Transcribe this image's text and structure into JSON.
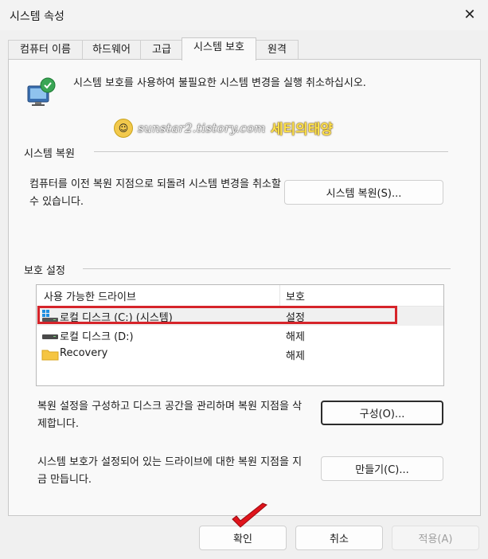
{
  "window": {
    "title": "시스템 속성",
    "close_glyph": "✕"
  },
  "tabs": [
    "컴퓨터 이름",
    "하드웨어",
    "고급",
    "시스템 보호",
    "원격"
  ],
  "intro_text": "시스템 보호를 사용하여 불필요한 시스템 변경을 실행 취소하십시오.",
  "watermark": {
    "url": "sunstar2.tistory.com",
    "name": "세티의태양"
  },
  "restore": {
    "section_title": "시스템 복원",
    "description": "컴퓨터를 이전 복원 지점으로 되돌려 시스템 변경을 취소할 수 있습니다.",
    "button_label": "시스템 복원(S)..."
  },
  "protection": {
    "section_title": "보호 설정",
    "columns": [
      "사용 가능한 드라이브",
      "보호"
    ],
    "drives": [
      {
        "name": "로컬 디스크 (C:) (시스템)",
        "status": "설정",
        "icon": "windows-drive-icon"
      },
      {
        "name": "로컬 디스크 (D:)",
        "status": "해제",
        "icon": "drive-icon"
      },
      {
        "name": "Recovery",
        "status": "해제",
        "icon": "folder-icon"
      }
    ],
    "configure_text": "복원 설정을 구성하고 디스크 공간을 관리하며 복원 지점을 삭제합니다.",
    "configure_label": "구성(O)...",
    "create_text": "시스템 보호가 설정되어 있는 드라이브에 대한 복원 지점을 지금 만듭니다.",
    "create_label": "만들기(C)..."
  },
  "footer": {
    "ok_label": "확인",
    "cancel_label": "취소",
    "apply_label": "적용(A)"
  },
  "colors": {
    "highlight_box": "#d6242a",
    "checkmark": "#e0141c"
  }
}
